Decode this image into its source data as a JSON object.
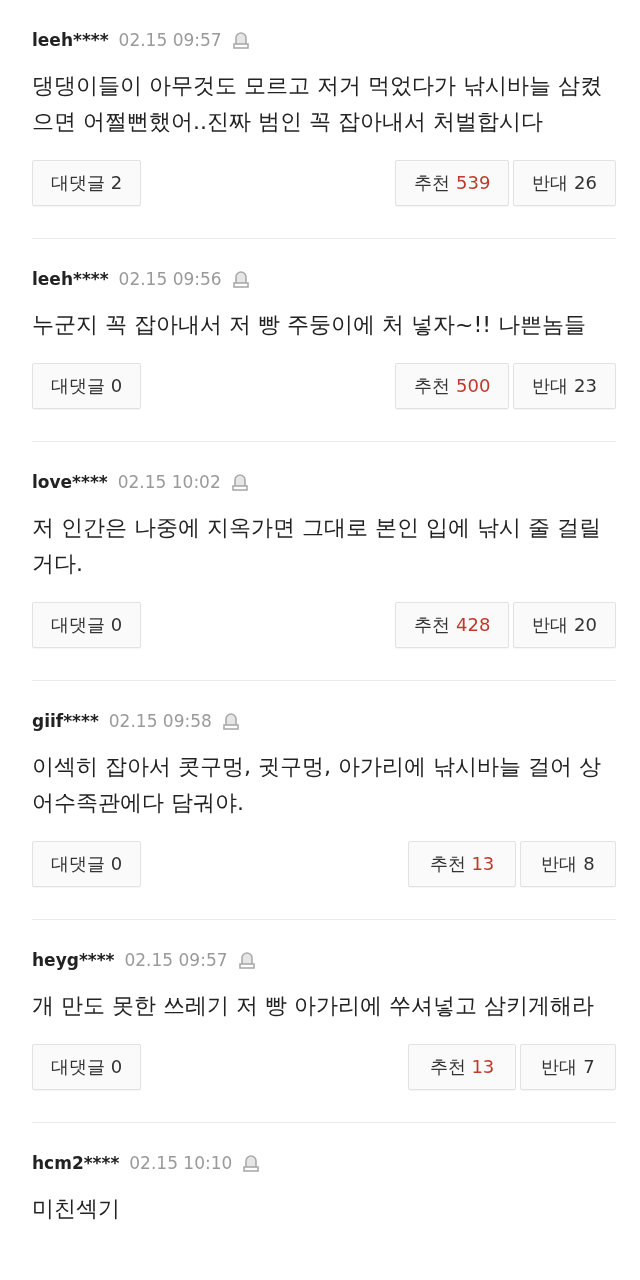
{
  "comments": [
    {
      "user": "leeh****",
      "time": "02.15 09:57",
      "text": "댕댕이들이 아무것도 모르고 저거 먹었다가 낚시바늘 삼켰으면 어쩔뻔했어..진짜 범인 꼭 잡아내서 처벌합시다",
      "reply_label": "대댓글",
      "reply_count": "2",
      "up_label": "추천",
      "up_count": "539",
      "down_label": "반대",
      "down_count": "26"
    },
    {
      "user": "leeh****",
      "time": "02.15 09:56",
      "text": "누군지 꼭 잡아내서 저 빵 주둥이에 처 넣자~!! 나쁜놈들",
      "reply_label": "대댓글",
      "reply_count": "0",
      "up_label": "추천",
      "up_count": "500",
      "down_label": "반대",
      "down_count": "23"
    },
    {
      "user": "love****",
      "time": "02.15 10:02",
      "text": "저 인간은 나중에 지옥가면 그대로 본인 입에 낚시 줄 걸릴거다.",
      "reply_label": "대댓글",
      "reply_count": "0",
      "up_label": "추천",
      "up_count": "428",
      "down_label": "반대",
      "down_count": "20"
    },
    {
      "user": "giif****",
      "time": "02.15 09:58",
      "text": "이섹히 잡아서 콧구멍, 귓구멍, 아가리에 낚시바늘 걸어 상어수족관에다 담궈야.",
      "reply_label": "대댓글",
      "reply_count": "0",
      "up_label": "추천",
      "up_count": "13",
      "down_label": "반대",
      "down_count": "8"
    },
    {
      "user": "heyg****",
      "time": "02.15 09:57",
      "text": "개 만도 못한 쓰레기 저 빵 아가리에 쑤셔넣고 삼키게해라",
      "reply_label": "대댓글",
      "reply_count": "0",
      "up_label": "추천",
      "up_count": "13",
      "down_label": "반대",
      "down_count": "7"
    },
    {
      "user": "hcm2****",
      "time": "02.15 10:10",
      "text": "미친섹기"
    }
  ]
}
